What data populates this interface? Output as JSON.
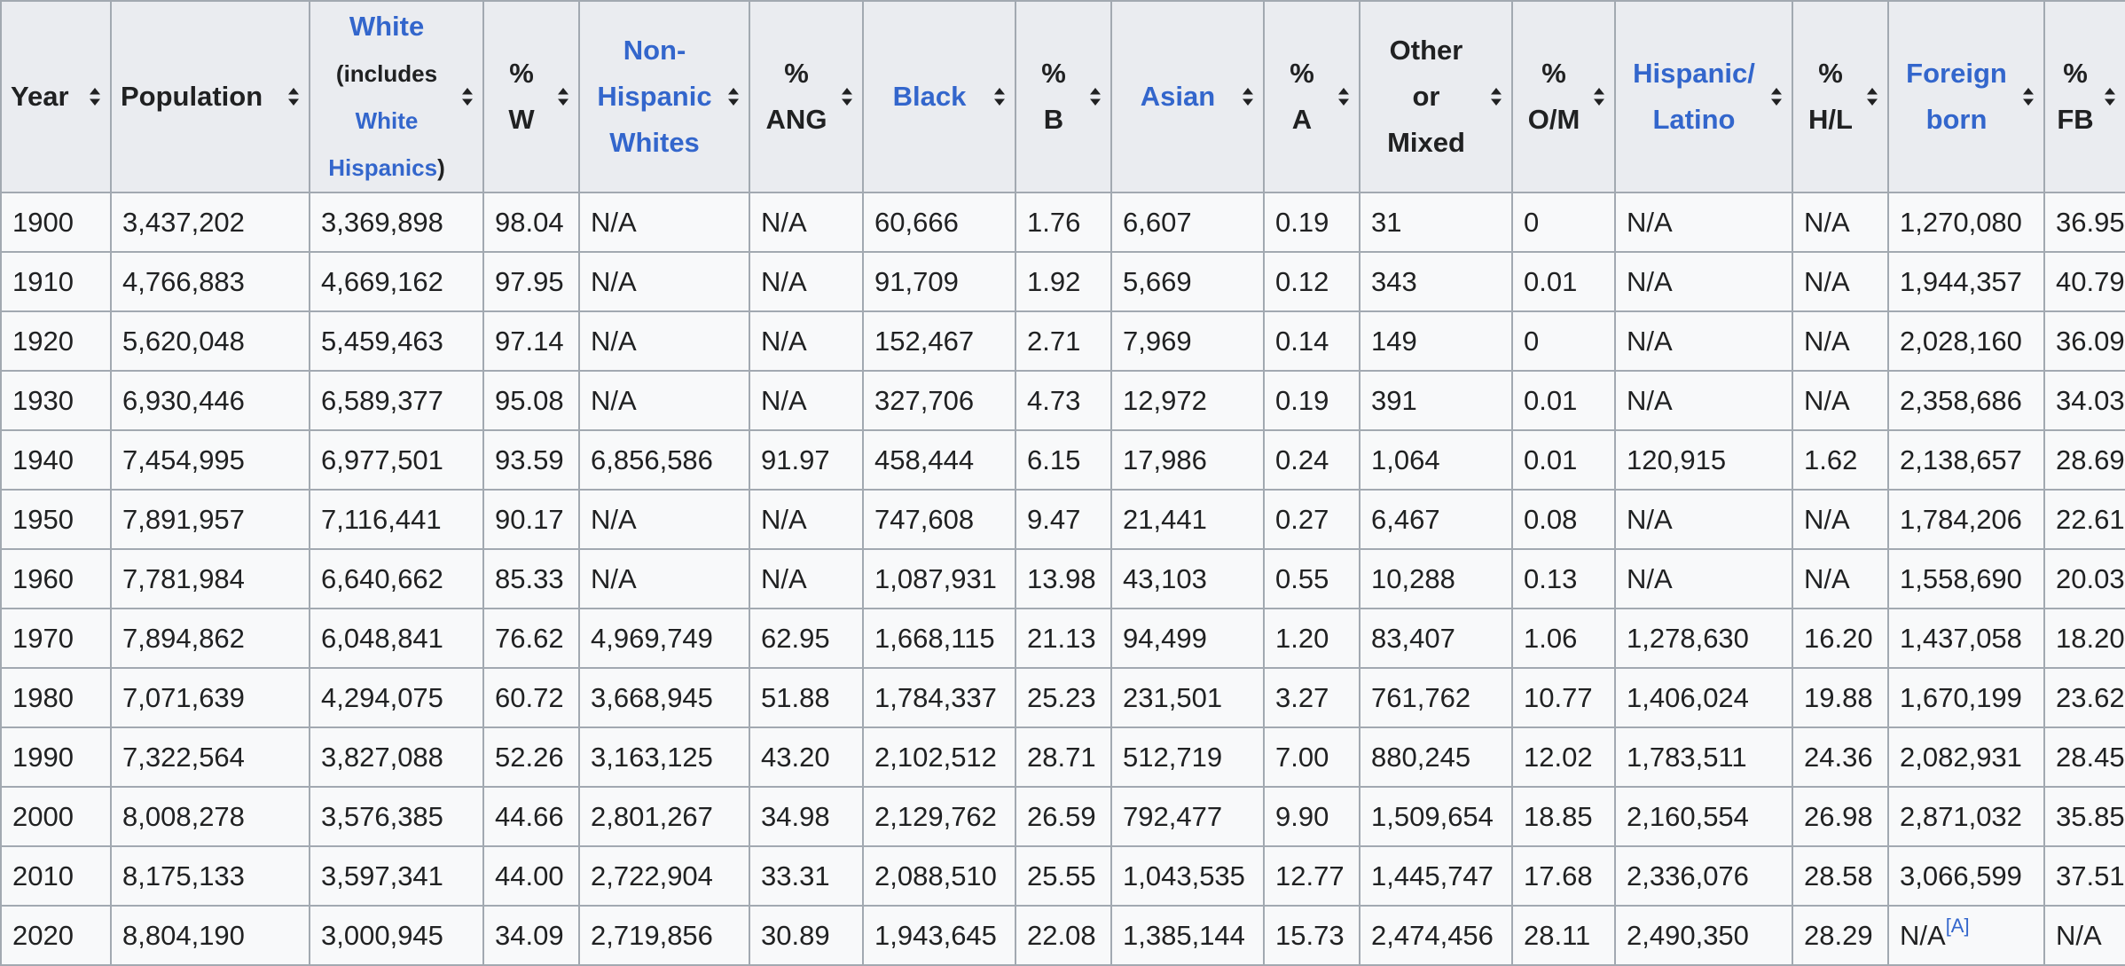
{
  "headers": [
    {
      "id": "year",
      "lines": [
        {
          "parts": [
            {
              "text": "Year"
            }
          ]
        }
      ]
    },
    {
      "id": "population",
      "lines": [
        {
          "parts": [
            {
              "text": "Population"
            }
          ]
        }
      ]
    },
    {
      "id": "white",
      "lines": [
        {
          "parts": [
            {
              "text": "White",
              "link": true
            }
          ]
        },
        {
          "parts": [
            {
              "text": "(includes",
              "small": true
            }
          ]
        },
        {
          "parts": [
            {
              "text": "White",
              "link": true,
              "small": true
            }
          ]
        },
        {
          "parts": [
            {
              "text": "Hispanics",
              "link": true,
              "small": true
            },
            {
              "text": ")",
              "small": true
            }
          ]
        }
      ]
    },
    {
      "id": "pct-w",
      "lines": [
        {
          "parts": [
            {
              "text": "%"
            }
          ]
        },
        {
          "parts": [
            {
              "text": "W"
            }
          ]
        }
      ]
    },
    {
      "id": "non-hispanic-whites",
      "lines": [
        {
          "parts": [
            {
              "text": "Non-",
              "link": true
            }
          ]
        },
        {
          "parts": [
            {
              "text": "Hispanic",
              "link": true
            }
          ]
        },
        {
          "parts": [
            {
              "text": "Whites",
              "link": true
            }
          ]
        }
      ]
    },
    {
      "id": "pct-ang",
      "lines": [
        {
          "parts": [
            {
              "text": "%"
            }
          ]
        },
        {
          "parts": [
            {
              "text": "ANG"
            }
          ]
        }
      ]
    },
    {
      "id": "black",
      "lines": [
        {
          "parts": [
            {
              "text": "Black",
              "link": true
            }
          ]
        }
      ]
    },
    {
      "id": "pct-b",
      "lines": [
        {
          "parts": [
            {
              "text": "%"
            }
          ]
        },
        {
          "parts": [
            {
              "text": "B"
            }
          ]
        }
      ]
    },
    {
      "id": "asian",
      "lines": [
        {
          "parts": [
            {
              "text": "Asian",
              "link": true
            }
          ]
        }
      ]
    },
    {
      "id": "pct-a",
      "lines": [
        {
          "parts": [
            {
              "text": "%"
            }
          ]
        },
        {
          "parts": [
            {
              "text": "A"
            }
          ]
        }
      ]
    },
    {
      "id": "other-mixed",
      "lines": [
        {
          "parts": [
            {
              "text": "Other"
            }
          ]
        },
        {
          "parts": [
            {
              "text": "or"
            }
          ]
        },
        {
          "parts": [
            {
              "text": "Mixed"
            }
          ]
        }
      ]
    },
    {
      "id": "pct-om",
      "lines": [
        {
          "parts": [
            {
              "text": "%"
            }
          ]
        },
        {
          "parts": [
            {
              "text": "O/M"
            }
          ]
        }
      ]
    },
    {
      "id": "hispanic-latino",
      "lines": [
        {
          "parts": [
            {
              "text": "Hispanic/",
              "link": true
            }
          ]
        },
        {
          "parts": [
            {
              "text": "Latino",
              "link": true
            }
          ]
        }
      ]
    },
    {
      "id": "pct-hl",
      "lines": [
        {
          "parts": [
            {
              "text": "%"
            }
          ]
        },
        {
          "parts": [
            {
              "text": "H/L"
            }
          ]
        }
      ]
    },
    {
      "id": "foreign-born",
      "lines": [
        {
          "parts": [
            {
              "text": "Foreign",
              "link": true
            }
          ]
        },
        {
          "parts": [
            {
              "text": "born",
              "link": true
            }
          ]
        }
      ]
    },
    {
      "id": "pct-fb",
      "lines": [
        {
          "parts": [
            {
              "text": "%"
            }
          ]
        },
        {
          "parts": [
            {
              "text": "FB"
            }
          ]
        }
      ]
    }
  ],
  "rows": [
    [
      "1900",
      "3,437,202",
      "3,369,898",
      "98.04",
      "N/A",
      "N/A",
      "60,666",
      "1.76",
      "6,607",
      "0.19",
      "31",
      "0",
      "N/A",
      "N/A",
      "1,270,080",
      "36.95"
    ],
    [
      "1910",
      "4,766,883",
      "4,669,162",
      "97.95",
      "N/A",
      "N/A",
      "91,709",
      "1.92",
      "5,669",
      "0.12",
      "343",
      "0.01",
      "N/A",
      "N/A",
      "1,944,357",
      "40.79"
    ],
    [
      "1920",
      "5,620,048",
      "5,459,463",
      "97.14",
      "N/A",
      "N/A",
      "152,467",
      "2.71",
      "7,969",
      "0.14",
      "149",
      "0",
      "N/A",
      "N/A",
      "2,028,160",
      "36.09"
    ],
    [
      "1930",
      "6,930,446",
      "6,589,377",
      "95.08",
      "N/A",
      "N/A",
      "327,706",
      "4.73",
      "12,972",
      "0.19",
      "391",
      "0.01",
      "N/A",
      "N/A",
      "2,358,686",
      "34.03"
    ],
    [
      "1940",
      "7,454,995",
      "6,977,501",
      "93.59",
      "6,856,586",
      "91.97",
      "458,444",
      "6.15",
      "17,986",
      "0.24",
      "1,064",
      "0.01",
      "120,915",
      "1.62",
      "2,138,657",
      "28.69"
    ],
    [
      "1950",
      "7,891,957",
      "7,116,441",
      "90.17",
      "N/A",
      "N/A",
      "747,608",
      "9.47",
      "21,441",
      "0.27",
      "6,467",
      "0.08",
      "N/A",
      "N/A",
      "1,784,206",
      "22.61"
    ],
    [
      "1960",
      "7,781,984",
      "6,640,662",
      "85.33",
      "N/A",
      "N/A",
      "1,087,931",
      "13.98",
      "43,103",
      "0.55",
      "10,288",
      "0.13",
      "N/A",
      "N/A",
      "1,558,690",
      "20.03"
    ],
    [
      "1970",
      "7,894,862",
      "6,048,841",
      "76.62",
      "4,969,749",
      "62.95",
      "1,668,115",
      "21.13",
      "94,499",
      "1.20",
      "83,407",
      "1.06",
      "1,278,630",
      "16.20",
      "1,437,058",
      "18.20"
    ],
    [
      "1980",
      "7,071,639",
      "4,294,075",
      "60.72",
      "3,668,945",
      "51.88",
      "1,784,337",
      "25.23",
      "231,501",
      "3.27",
      "761,762",
      "10.77",
      "1,406,024",
      "19.88",
      "1,670,199",
      "23.62"
    ],
    [
      "1990",
      "7,322,564",
      "3,827,088",
      "52.26",
      "3,163,125",
      "43.20",
      "2,102,512",
      "28.71",
      "512,719",
      "7.00",
      "880,245",
      "12.02",
      "1,783,511",
      "24.36",
      "2,082,931",
      "28.45"
    ],
    [
      "2000",
      "8,008,278",
      "3,576,385",
      "44.66",
      "2,801,267",
      "34.98",
      "2,129,762",
      "26.59",
      "792,477",
      "9.90",
      "1,509,654",
      "18.85",
      "2,160,554",
      "26.98",
      "2,871,032",
      "35.85"
    ],
    [
      "2010",
      "8,175,133",
      "3,597,341",
      "44.00",
      "2,722,904",
      "33.31",
      "2,088,510",
      "25.55",
      "1,043,535",
      "12.77",
      "1,445,747",
      "17.68",
      "2,336,076",
      "28.58",
      "3,066,599",
      "37.51"
    ],
    [
      "2020",
      "8,804,190",
      "3,000,945",
      "34.09",
      "2,719,856",
      "30.89",
      "1,943,645",
      "22.08",
      "1,385,144",
      "15.73",
      "2,474,456",
      "28.11",
      "2,490,350",
      "28.29",
      {
        "text": "N/A",
        "ref": "[A]"
      },
      "N/A"
    ]
  ],
  "icons": {
    "sort": "sort-icon"
  },
  "colors": {
    "link": "#3366cc",
    "header_bg": "#eaecf0",
    "cell_bg": "#f8f9fa",
    "border": "#a2a9b1",
    "text": "#202122"
  }
}
